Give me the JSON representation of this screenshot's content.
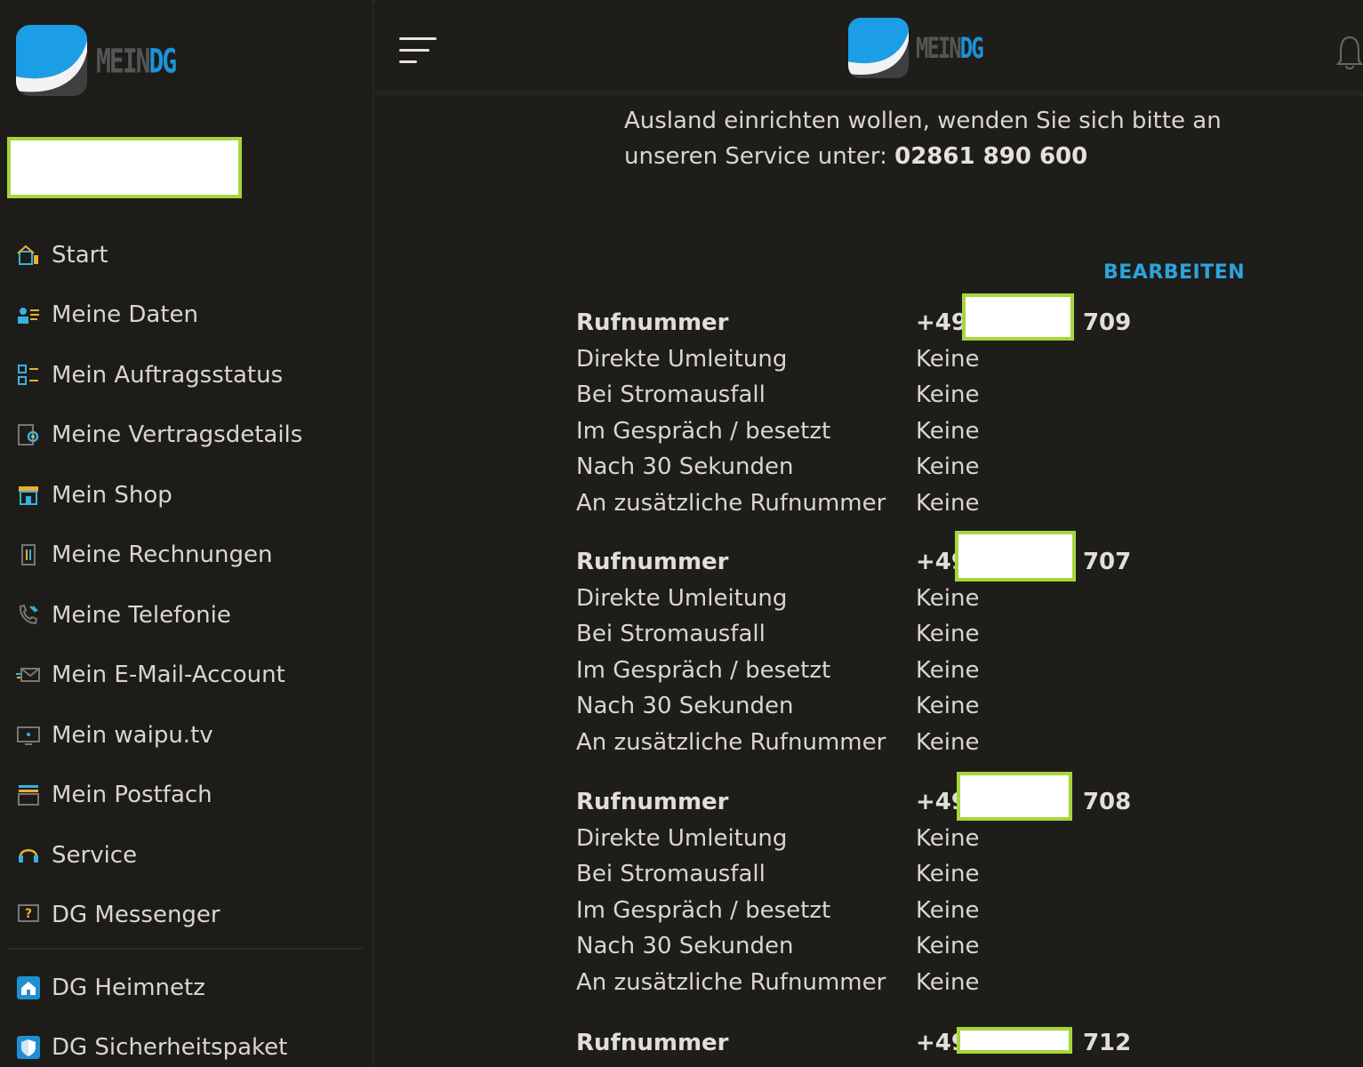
{
  "brand": {
    "mein": "MEIN",
    "dg": "DG"
  },
  "sidebar": {
    "items": [
      {
        "label": "Start",
        "icon": "start-icon"
      },
      {
        "label": "Meine Daten",
        "icon": "user-data-icon"
      },
      {
        "label": "Mein Auftragsstatus",
        "icon": "order-status-icon"
      },
      {
        "label": "Meine Vertragsdetails",
        "icon": "contract-icon"
      },
      {
        "label": "Mein Shop",
        "icon": "shop-icon"
      },
      {
        "label": "Meine Rechnungen",
        "icon": "invoice-icon"
      },
      {
        "label": "Meine Telefonie",
        "icon": "phone-icon"
      },
      {
        "label": "Mein E-Mail-Account",
        "icon": "email-icon"
      },
      {
        "label": "Mein waipu.tv",
        "icon": "tv-icon"
      },
      {
        "label": "Mein Postfach",
        "icon": "mailbox-icon"
      },
      {
        "label": "Service",
        "icon": "headset-icon"
      },
      {
        "label": "DG Messenger",
        "icon": "messenger-icon"
      }
    ],
    "extra_items": [
      {
        "label": "DG Heimnetz",
        "icon": "home-network-icon"
      },
      {
        "label": "DG Sicherheitspaket",
        "icon": "shield-icon"
      }
    ]
  },
  "info": {
    "line1": "Ausland einrichten wollen, wenden Sie sich bitte an",
    "line2_prefix": "unseren Service unter: ",
    "phone": "02861 890 600"
  },
  "edit_label": "BEARBEITEN",
  "labels": {
    "number": "Rufnummer",
    "direct": "Direkte Umleitung",
    "power": "Bei Stromausfall",
    "busy": "Im Gespräch / besetzt",
    "after30": "Nach 30 Sekunden",
    "additional": "An zusätzliche Rufnummer"
  },
  "numbers": [
    {
      "prefix": "+49",
      "suffix": "709",
      "direct": "Keine",
      "power": "Keine",
      "busy": "Keine",
      "after30": "Keine",
      "additional": "Keine"
    },
    {
      "prefix": "+49",
      "suffix": "707",
      "direct": "Keine",
      "power": "Keine",
      "busy": "Keine",
      "after30": "Keine",
      "additional": "Keine"
    },
    {
      "prefix": "+49",
      "suffix": "708",
      "direct": "Keine",
      "power": "Keine",
      "busy": "Keine",
      "after30": "Keine",
      "additional": "Keine"
    },
    {
      "prefix": "+49",
      "suffix": "712"
    }
  ]
}
